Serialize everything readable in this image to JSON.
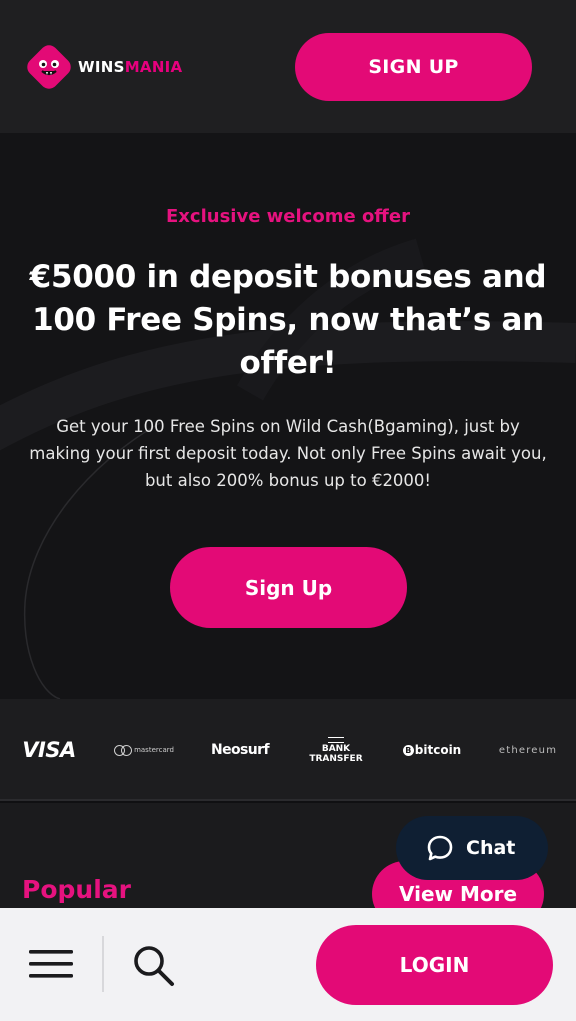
{
  "header": {
    "logo_wins": "WINS",
    "logo_mania": "MANIA",
    "signup_label": "SIGN UP"
  },
  "hero": {
    "kicker": "Exclusive welcome offer",
    "title": "€5000 in deposit bonuses and 100 Free Spins, now that’s an offer!",
    "description": "Get your 100 Free Spins on Wild Cash(Bgaming), just by making your first deposit today. Not only Free Spins await you, but also 200% bonus up to €2000!",
    "signup_label": "Sign Up"
  },
  "payments": {
    "visa": "VISA",
    "mastercard": "mastercard",
    "neosurf": "Neosurf",
    "bank_line1": "BANK",
    "bank_line2": "TRANSFER",
    "bitcoin": "bitcoin",
    "bitcoin_symbol": "B",
    "ethereum": "ethereum"
  },
  "popular": {
    "title": "Popular",
    "view_more_label": "View More"
  },
  "chat": {
    "label": "Chat"
  },
  "bottom_bar": {
    "login_label": "LOGIN",
    "menu_icon": "hamburger-menu-icon",
    "search_icon": "search-icon"
  },
  "colors": {
    "brand_pink": "#e30a76",
    "chat_navy": "#0f1f33",
    "header_bg": "#1f1f21",
    "bottom_bar_bg": "#f2f2f4"
  }
}
